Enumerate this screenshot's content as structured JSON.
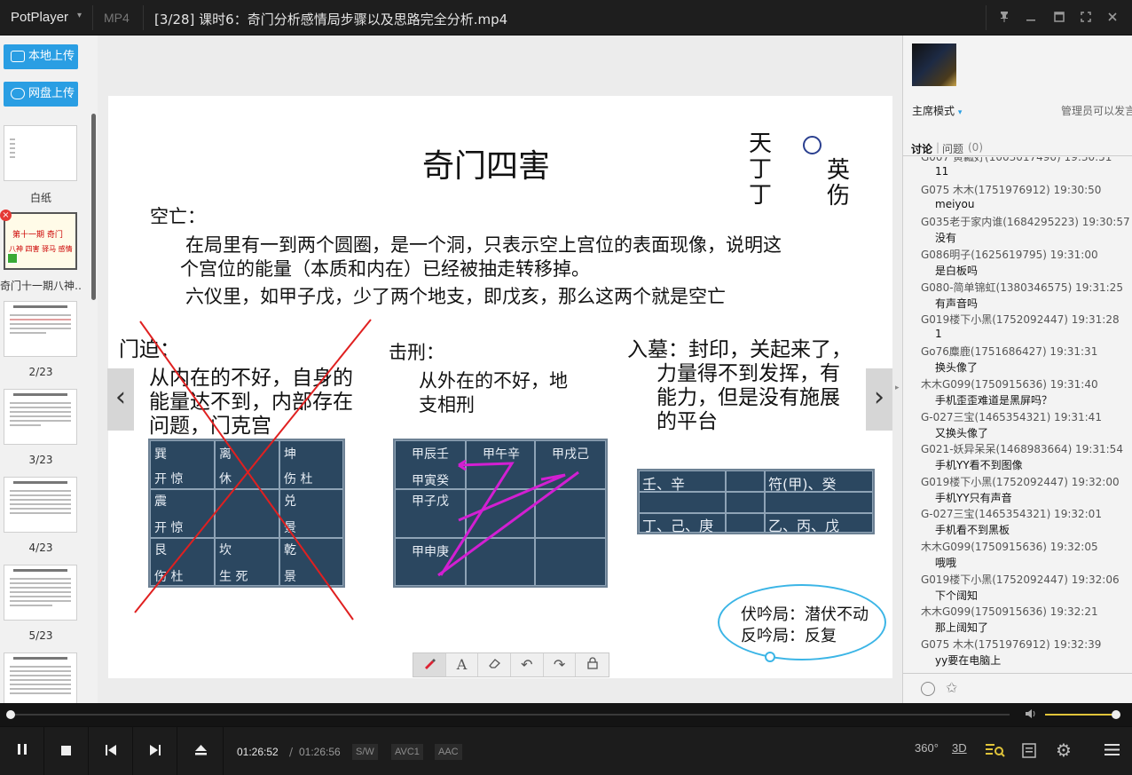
{
  "app": {
    "name": "PotPlayer",
    "format": "MP4",
    "title": "[3/28] 课时6：奇门分析感情局步骤以及思路完全分析.mp4"
  },
  "sidebar": {
    "upload_local": "本地上传",
    "upload_cloud": "网盘上传",
    "thumbnails": [
      {
        "label": "白纸"
      },
      {
        "label": "奇门十一期八神…",
        "preview_title": "第十一期 奇门",
        "preview_sub": "八神 四害 驿马 感情"
      },
      {
        "label": "2/23"
      },
      {
        "label": "3/23"
      },
      {
        "label": "4/23"
      },
      {
        "label": "5/23"
      }
    ]
  },
  "slide": {
    "title": "奇门四害",
    "side_chars": {
      "col1": [
        "天",
        "丁",
        "丁"
      ],
      "col2": [
        "英",
        "伤"
      ]
    },
    "kongwang_heading": "空亡：",
    "kongwang_line1": "在局里有一到两个圆圈，是一个洞，只表示空上宫位的表面现像，说明这",
    "kongwang_line2": "个宫位的能量（本质和内在）已经被抽走转移掉。",
    "kongwang_line3": "六仪里，如甲子戊，少了两个地支，即戊亥，那么这两个就是空亡",
    "menpo_heading": "门迫：",
    "menpo_line1": "从内在的不好，自身的",
    "menpo_line2": "能量达不到，内部存在",
    "menpo_line3": "问题，门克宫",
    "jixing_heading": "击刑：",
    "jixing_line1": "从外在的不好，地",
    "jixing_line2": "支相刑",
    "rumu_line1": "入墓：封印，关起来了，",
    "rumu_line2": "力量得不到发挥，有",
    "rumu_line3": "能力，但是没有施展",
    "rumu_line4": "的平台",
    "grid1": [
      [
        "巽",
        "开 惊"
      ],
      [
        "离",
        "休"
      ],
      [
        "坤",
        "伤 杜"
      ],
      [
        "震",
        "开 惊"
      ],
      [
        "",
        ""
      ],
      [
        "兑",
        "景"
      ],
      [
        "艮",
        "伤 杜"
      ],
      [
        "坎",
        "生 死"
      ],
      [
        "乾",
        "景"
      ]
    ],
    "grid2": [
      "甲辰壬",
      "甲午辛",
      "甲戌己",
      "甲寅癸",
      "甲子戊",
      "甲申庚"
    ],
    "grid3": [
      "壬、辛",
      "符(甲)、癸",
      "丁、己、庚",
      "乙、丙、戊"
    ],
    "cloud_line1": "伏吟局：潜伏不动",
    "cloud_line2": "反吟局：反复"
  },
  "chat": {
    "mode": "主席模式",
    "admin_note": "管理员可以发言",
    "tab_discuss": "讨论",
    "tab_questions": "问题",
    "question_count": "(0)",
    "messages": [
      {
        "who": "G007 黄瓤好(1003017490) 19:30:51",
        "text": "11"
      },
      {
        "who": "G075 木木(1751976912) 19:30:50",
        "text": "meiyou"
      },
      {
        "who": "G035老于家内谁(1684295223) 19:30:57",
        "text": "没有"
      },
      {
        "who": "G086明子(1625619795) 19:31:00",
        "text": "是白板吗"
      },
      {
        "who": "G080-简单锦虹(1380346575) 19:31:25",
        "text": "有声音吗"
      },
      {
        "who": "G019楼下小黑(1752092447) 19:31:28",
        "text": "1"
      },
      {
        "who": "Go76麋鹿(1751686427) 19:31:31",
        "text": "换头像了"
      },
      {
        "who": "木木G099(1750915636) 19:31:40",
        "text": "手机歪歪难道是黑屏吗？"
      },
      {
        "who": "G-027三宝(1465354321) 19:31:41",
        "text": "又换头像了"
      },
      {
        "who": "G021-妖异呆呆(1468983664) 19:31:54",
        "text": "手机YY看不到图像"
      },
      {
        "who": "G019楼下小黑(1752092447) 19:32:00",
        "text": "手机YY只有声音"
      },
      {
        "who": "G-027三宝(1465354321) 19:32:01",
        "text": "手机看不到黑板"
      },
      {
        "who": "木木G099(1750915636) 19:32:05",
        "text": "哦哦"
      },
      {
        "who": "G019楼下小黑(1752092447) 19:32:06",
        "text": "下个阔知"
      },
      {
        "who": "木木G099(1750915636) 19:32:21",
        "text": "那上阔知了"
      },
      {
        "who": "G075 木木(1751976912) 19:32:39",
        "text": "yy要在电脑上"
      }
    ]
  },
  "player": {
    "time_current": "01:26:52",
    "time_sep": "/",
    "time_total": "01:26:56",
    "tag_sw": "S/W",
    "tag_codec": "AVC1",
    "tag_audio": "AAC",
    "btn_360": "360°",
    "btn_3d": "3D",
    "seek_progress": 0.0,
    "volume_level": 1.0
  }
}
